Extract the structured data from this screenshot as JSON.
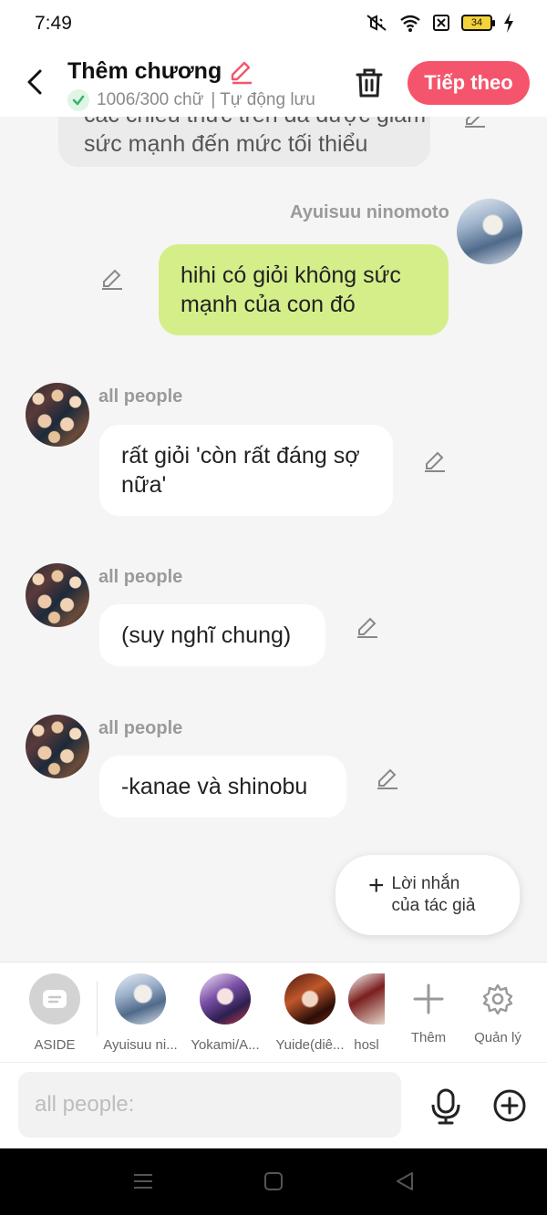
{
  "status": {
    "time": "7:49",
    "battery": "34"
  },
  "header": {
    "title": "Thêm chương",
    "word_count": "1006/300 chữ",
    "autosave": "| Tự động lưu",
    "next_button": "Tiếp theo"
  },
  "messages": [
    {
      "sender": "",
      "text": "sức mạnh đến mức tối thiểu",
      "partial_top": "các chiêu thức trên đã được giảm"
    },
    {
      "sender": "Ayuisuu ninomoto",
      "text": "hihi có giỏi không sức mạnh của con đó"
    },
    {
      "sender": "all people",
      "text": "rất giỏi 'còn rất đáng sợ nữa'"
    },
    {
      "sender": "all people",
      "text": "(suy nghĩ chung)"
    },
    {
      "sender": "all people",
      "text": "-kanae và shinobu"
    }
  ],
  "fab": {
    "line1": "Lời nhắn",
    "line2": "của tác giả"
  },
  "characters": [
    {
      "label": "ASIDE"
    },
    {
      "label": "Ayuisuu ni..."
    },
    {
      "label": "Yokami/A..."
    },
    {
      "label": "Yuide(diê..."
    },
    {
      "label": "hosl"
    },
    {
      "label": "Thêm"
    },
    {
      "label": "Quản lý"
    }
  ],
  "input": {
    "placeholder": "all people:"
  },
  "colors": {
    "accent": "#f5556c",
    "own_bubble": "#d4ee8a",
    "check": "#3cb371"
  }
}
